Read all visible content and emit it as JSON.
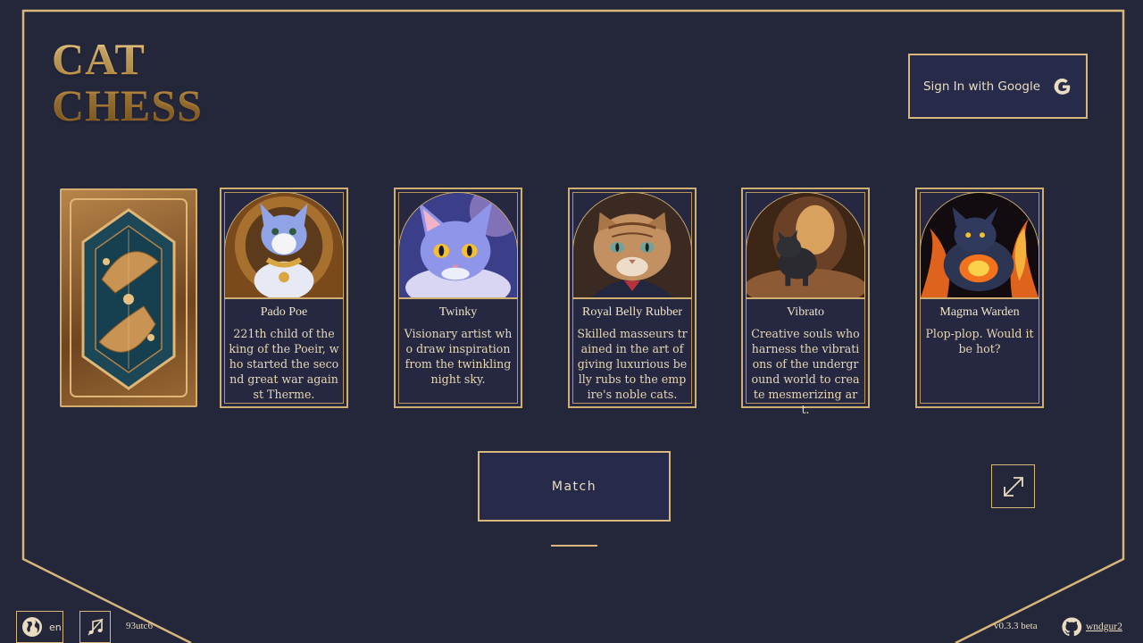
{
  "app": {
    "logo_line1": "CAT",
    "logo_line2": "CHESS"
  },
  "header": {
    "signin_label": "Sign In with Google",
    "signin_icon": "google-g-icon"
  },
  "deck": {
    "back_icon": "ornate-card-back"
  },
  "cards": [
    {
      "name": "Pado Poe",
      "description": "221th child of the king of the Poeir, who started the second great war against Therme.",
      "art": "blue-white-cat-with-gold-collar"
    },
    {
      "name": "Twinky",
      "description": "Visionary artist who draw inspiration from the twinkling night sky.",
      "art": "blue-cat-yellow-eyes"
    },
    {
      "name": "Royal Belly Rubber",
      "description": "Skilled masseurs trained in the art of giving luxurious belly rubs to the empire's noble cats.",
      "art": "tabby-cat-in-suit"
    },
    {
      "name": "Vibrato",
      "description": "Creative souls who harness the vibrations of the underground world to create mesmerizing art.",
      "art": "black-cat-in-cave"
    },
    {
      "name": "Magma Warden",
      "description": "Plop-plop. Would it be hot?",
      "art": "dark-cat-with-flames"
    }
  ],
  "actions": {
    "match_label": "Match",
    "expand_icon": "expand-arrows-icon"
  },
  "footer": {
    "language": "en",
    "globe_icon": "globe-icon",
    "music_icon": "music-note-icon",
    "build_id": "93utc6",
    "version": "v0.3.3 beta",
    "github_user": "wndgur2",
    "github_icon": "github-icon"
  },
  "colors": {
    "background": "#24263a",
    "gold": "#d7b77b",
    "button_fill": "#272a48",
    "text": "#e9dcc0"
  }
}
